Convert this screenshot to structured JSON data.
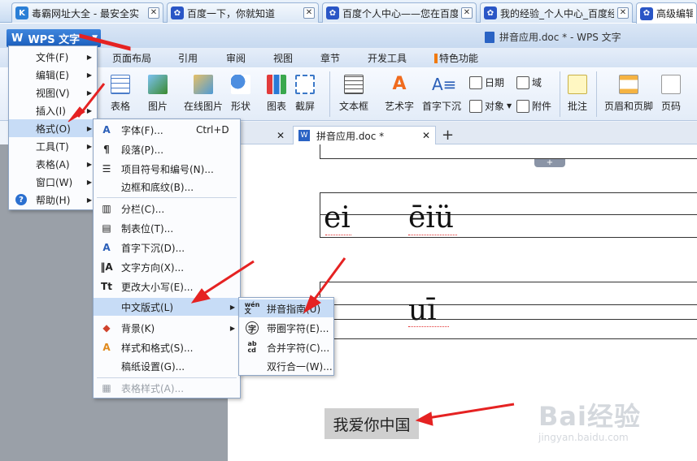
{
  "browser_tabs": [
    {
      "title": "毒霸网址大全 - 最安全实",
      "color": "#2b7fd6",
      "glyph": "K",
      "active": false
    },
    {
      "title": "百度一下，你就知道",
      "color": "#2a56c6",
      "glyph": "🐾",
      "active": false
    },
    {
      "title": "百度个人中心——您在百度",
      "color": "#2a56c6",
      "glyph": "🐾",
      "active": false
    },
    {
      "title": "我的经验_个人中心_百度经",
      "color": "#2a56c6",
      "glyph": "🐾",
      "active": false
    },
    {
      "title": "高级编辑器",
      "color": "#2a56c6",
      "glyph": "🐾",
      "active": true
    }
  ],
  "wps": {
    "app_button": "WPS 文字",
    "doc_title": "拼音应用.doc * - WPS 文字",
    "menus": [
      "页面布局",
      "引用",
      "审阅",
      "视图",
      "章节",
      "开发工具",
      "特色功能"
    ],
    "ribbon": {
      "big": [
        "表格",
        "图片",
        "在线图片",
        "形状",
        "图表",
        "截屏",
        "文本框",
        "艺术字",
        "首字下沉",
        "批注",
        "页眉和页脚",
        "页码"
      ],
      "small": [
        "日期",
        "域",
        "对象",
        "附件"
      ]
    },
    "doc_tab": "拼音应用.doc *"
  },
  "document": {
    "line1_pinyin": [
      "ei",
      "ēiü"
    ],
    "line2_pinyin": [
      "uī"
    ],
    "text": "我爱你中国"
  },
  "main_menu": [
    {
      "label": "文件(F)",
      "arrow": true
    },
    {
      "label": "编辑(E)",
      "arrow": true
    },
    {
      "label": "视图(V)",
      "arrow": true
    },
    {
      "label": "插入(I)",
      "arrow": true
    },
    {
      "label": "格式(O)",
      "arrow": true,
      "active": true
    },
    {
      "label": "工具(T)",
      "arrow": true
    },
    {
      "label": "表格(A)",
      "arrow": true
    },
    {
      "label": "窗口(W)",
      "arrow": true
    },
    {
      "label": "帮助(H)",
      "arrow": true
    }
  ],
  "format_menu": [
    {
      "label": "字体(F)...",
      "shortcut": "Ctrl+D",
      "icon": "A"
    },
    {
      "label": "段落(P)...",
      "icon": "¶"
    },
    {
      "label": "项目符号和编号(N)...",
      "icon": "≡"
    },
    {
      "label": "边框和底纹(B)...",
      "icon": ""
    },
    {
      "label": "分栏(C)...",
      "icon": "▥"
    },
    {
      "label": "制表位(T)...",
      "icon": "▤"
    },
    {
      "label": "首字下沉(D)...",
      "icon": "A"
    },
    {
      "label": "文字方向(X)...",
      "icon": "|A"
    },
    {
      "label": "更改大小写(E)...",
      "icon": "Tt"
    },
    {
      "label": "中文版式(L)",
      "arrow": true,
      "active": true
    },
    {
      "label": "背景(K)",
      "arrow": true,
      "icon": "◆"
    },
    {
      "label": "样式和格式(S)...",
      "icon": "A"
    },
    {
      "label": "稿纸设置(G)...",
      "icon": ""
    },
    {
      "label": "表格样式(A)...",
      "icon": "▦",
      "disabled": true
    }
  ],
  "chinese_layout_menu": [
    {
      "label": "拼音指南(U)",
      "icon": "wén",
      "active": true
    },
    {
      "label": "带圈字符(E)...",
      "icon": "字"
    },
    {
      "label": "合并字符(C)...",
      "icon": "ab"
    },
    {
      "label": "双行合一(W)...",
      "icon": ""
    }
  ],
  "watermark": {
    "brand": "Bai经验",
    "url": "jingyan.baidu.com"
  },
  "colors": {
    "accent": "#1c5fbd",
    "highlight": "#c7dcf6",
    "arrow": "#e52222"
  }
}
